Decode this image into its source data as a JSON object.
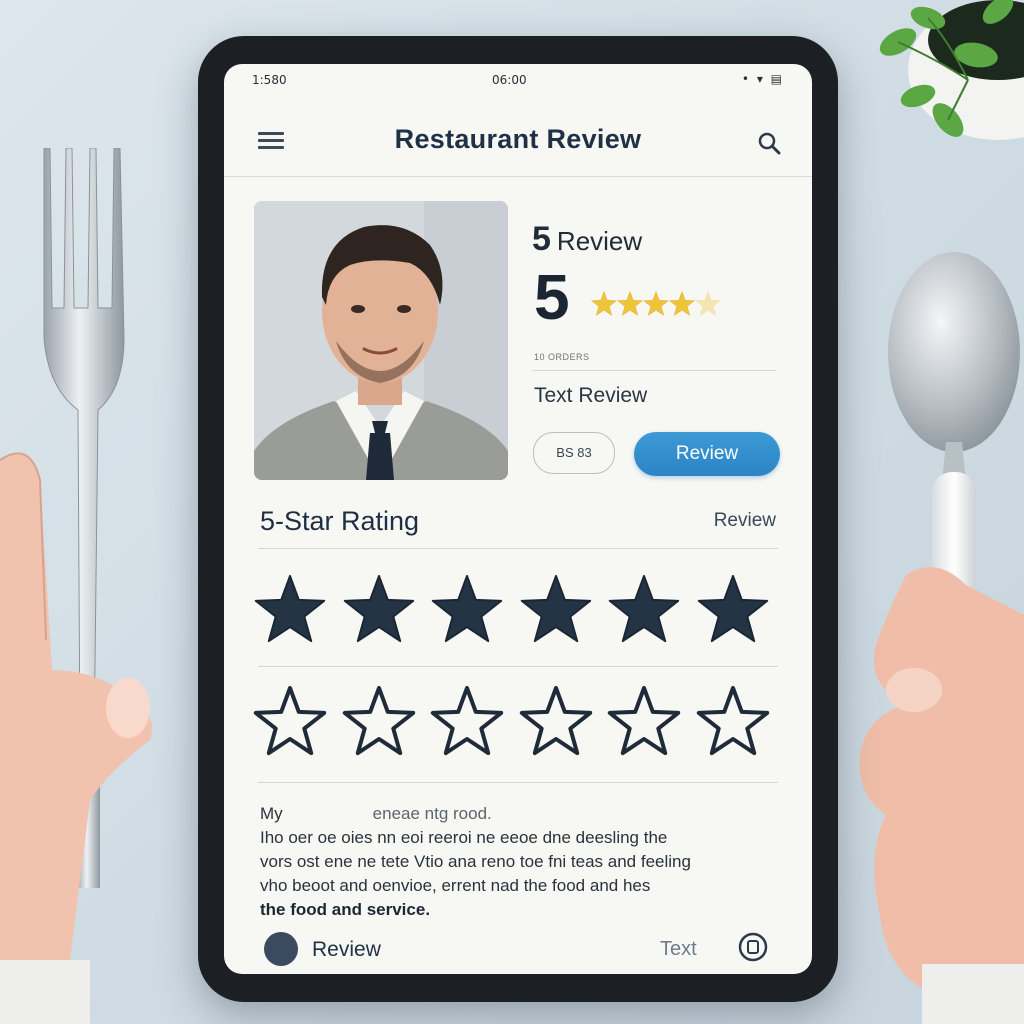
{
  "status_bar": {
    "time": "1:580",
    "clock": "06:00",
    "icons": "• ▾ ▤"
  },
  "header": {
    "title": "Restaurant Review"
  },
  "summary": {
    "count": "5",
    "label": "Review",
    "score": "5",
    "stars": 5,
    "meta": "10 ORDERS",
    "text_review_label": "Text Review",
    "code_button": "BS 83",
    "review_button": "Review"
  },
  "rating": {
    "title": "5-Star Rating",
    "link": "Review",
    "filled_row_count": 6,
    "outline_row_count": 6
  },
  "review_text": {
    "line1": "My",
    "line1_end": "eneae ntg rood.",
    "line2": "Iho oer oe oies nn eoi reeroi ne eeoe dne deesling  the",
    "line3": "vors ost ene ne tete Vtio ana reno toe fni teas and feeling",
    "line4": "vho beoot and oenvioe, errent nad the food and hes",
    "line5": "the food and service."
  },
  "bottom_bar": {
    "review": "Review",
    "text": "Text"
  },
  "colors": {
    "accent": "#2c84c4",
    "star_fill": "#243445",
    "mini_star": "#f0c43a"
  }
}
